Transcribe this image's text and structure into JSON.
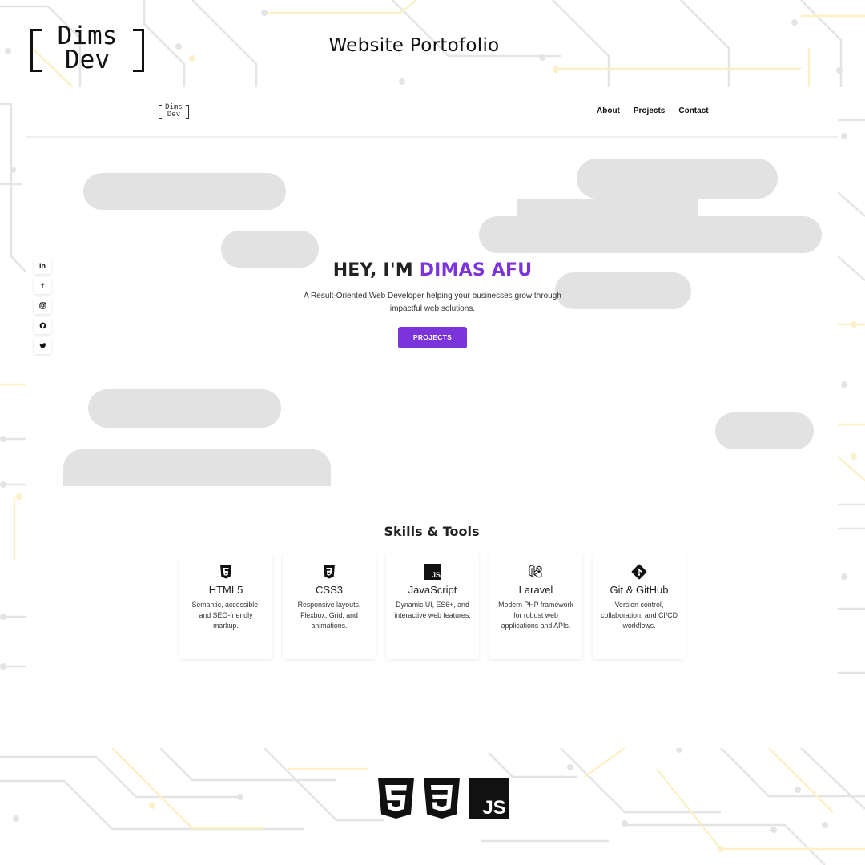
{
  "header": {
    "logo_line1": "Dims",
    "logo_line2": "Dev",
    "title": "Website Portofolio"
  },
  "navbar": {
    "logo_line1": "Dims",
    "logo_line2": "Dev",
    "links": [
      {
        "label": "About"
      },
      {
        "label": "Projects"
      },
      {
        "label": "Contact"
      }
    ]
  },
  "social": [
    {
      "icon": "linkedin-icon",
      "glyph": "in"
    },
    {
      "icon": "facebook-icon",
      "glyph": "f"
    },
    {
      "icon": "instagram-icon"
    },
    {
      "icon": "github-icon"
    },
    {
      "icon": "twitter-icon"
    }
  ],
  "hero": {
    "greeting": "HEY, I'M ",
    "name": "DIMAS AFU",
    "subtitle_line1": "A Result-Oriented Web Developer helping your businesses grow through",
    "subtitle_line2": "impactful web solutions.",
    "cta_label": "PROJECTS"
  },
  "skills": {
    "title": "Skills & Tools",
    "items": [
      {
        "icon": "html5-icon",
        "name": "HTML5",
        "desc": "Semantic, accessible, and SEO-friendly markup."
      },
      {
        "icon": "css3-icon",
        "name": "CSS3",
        "desc": "Responsive layouts, Flexbox, Grid, and animations."
      },
      {
        "icon": "javascript-icon",
        "name": "JavaScript",
        "desc": "Dynamic UI, ES6+, and interactive web features."
      },
      {
        "icon": "laravel-icon",
        "name": "Laravel",
        "desc": "Modern PHP framework for robust web applications and APIs."
      },
      {
        "icon": "git-icon",
        "name": "Git & GitHub",
        "desc": "Version control, collaboration, and CI/CD workflows."
      }
    ]
  },
  "footer_logos": {
    "js_label": "JS"
  },
  "colors": {
    "accent": "#7a34d9",
    "blob": "#e2e2e2",
    "circuit_gray": "#e4e4e4",
    "circuit_yellow": "#fbf0c8"
  }
}
